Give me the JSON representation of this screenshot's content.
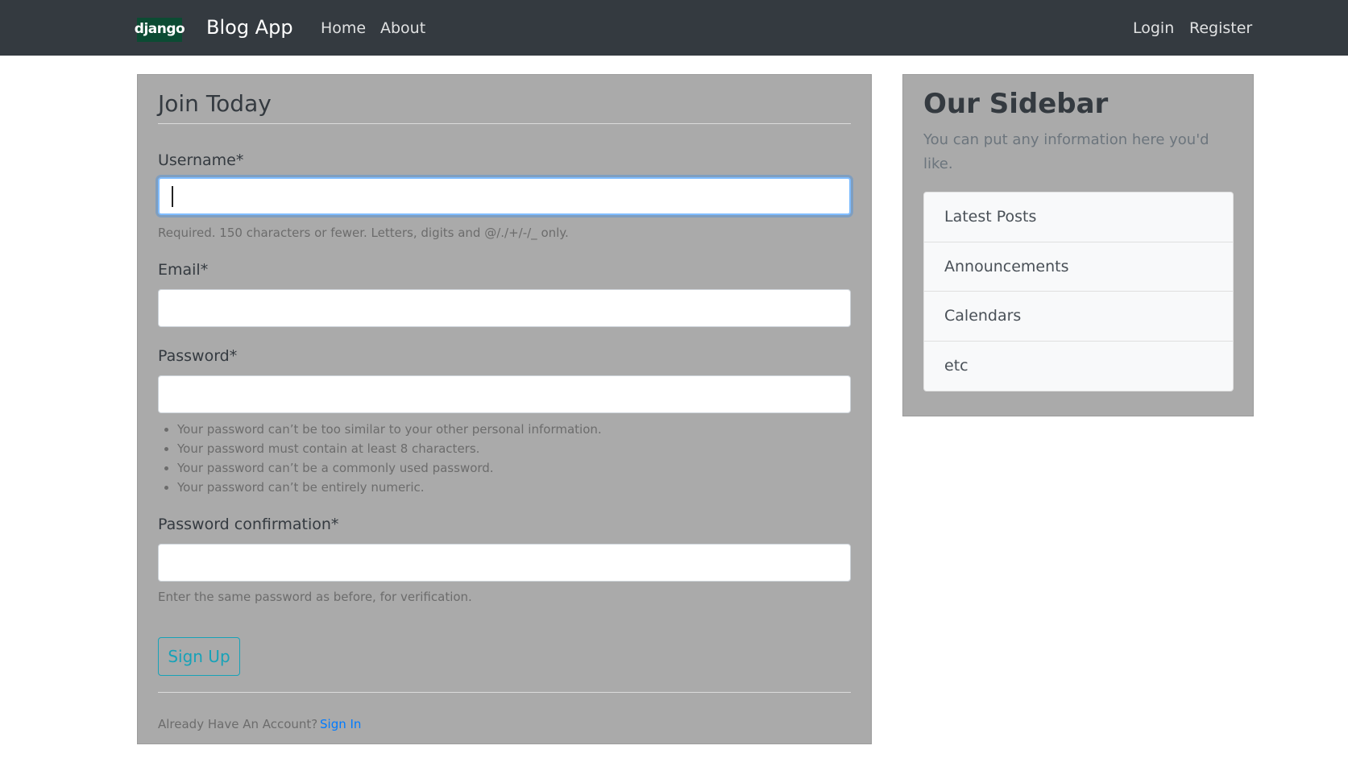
{
  "navbar": {
    "logo_text": "django",
    "brand": "Blog App",
    "links": {
      "home": "Home",
      "about": "About",
      "login": "Login",
      "register": "Register"
    }
  },
  "form": {
    "legend": "Join Today",
    "username": {
      "label": "Username*",
      "value": "",
      "help": "Required. 150 characters or fewer. Letters, digits and @/./+/-/_ only."
    },
    "email": {
      "label": "Email*",
      "value": ""
    },
    "password": {
      "label": "Password*",
      "value": "",
      "help_items": [
        "Your password can’t be too similar to your other personal information.",
        "Your password must contain at least 8 characters.",
        "Your password can’t be a commonly used password.",
        "Your password can’t be entirely numeric."
      ]
    },
    "password_confirmation": {
      "label": "Password confirmation*",
      "value": "",
      "help": "Enter the same password as before, for verification."
    },
    "submit_label": "Sign Up",
    "footer_text": "Already Have An Account?",
    "signin_link": "Sign In"
  },
  "sidebar": {
    "title": "Our Sidebar",
    "description": "You can put any information here you'd like.",
    "items": [
      "Latest Posts",
      "Announcements",
      "Calendars",
      "etc"
    ]
  },
  "colors": {
    "navbar_bg": "#343a40",
    "card_bg": "#aaaaaa",
    "accent_info": "#17a2b8",
    "link": "#007bff",
    "logo_bg": "#0c4b33"
  },
  "icons": {
    "logo": "django-logo"
  }
}
